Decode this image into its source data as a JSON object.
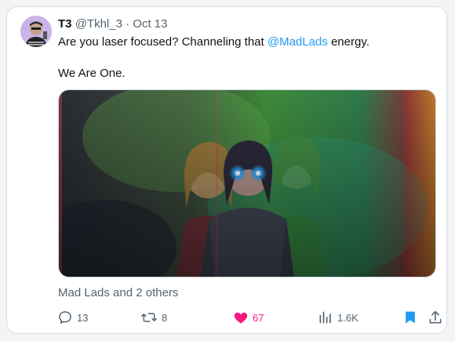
{
  "post": {
    "author_name": "T3",
    "author_handle": "@Tkhl_3",
    "separator": "·",
    "date": "Oct 13",
    "text_before_mention": "Are you laser focused? Channeling that ",
    "mention": "@MadLads",
    "text_after_mention": " energy.",
    "second_line": "We Are One.",
    "tagged": "Mad Lads and 2 others"
  },
  "actions": {
    "replies": "13",
    "reposts": "8",
    "likes": "67",
    "views": "1.6K"
  },
  "colors": {
    "accent": "#1d9bf0",
    "like": "#f91880",
    "secondary_text": "#536471"
  },
  "icons": [
    "reply-icon",
    "repost-icon",
    "heart-icon",
    "views-icon",
    "bookmark-icon",
    "share-icon"
  ]
}
